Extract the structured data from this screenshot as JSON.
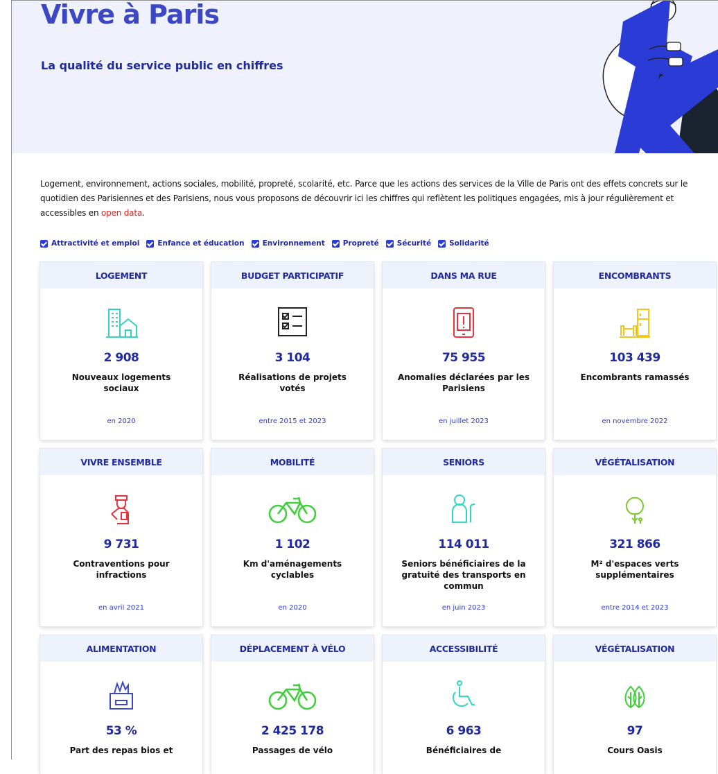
{
  "hero": {
    "title": "Vivre à Paris",
    "subtitle": "La qualité du service public en chiffres"
  },
  "intro": {
    "text": "Logement, environnement, actions sociales, mobilité, propreté, scolarité, etc. Parce que les actions des services de la Ville de Paris ont des effets concrets sur le quotidien des Parisiennes et des Parisiens, nous vous proposons de découvrir ici les chiffres qui reflètent les politiques engagées, mis à jour régulièrement et accessibles en ",
    "link_label": "open data",
    "suffix": "."
  },
  "filters": [
    {
      "label": "Attractivité et emploi",
      "checked": true
    },
    {
      "label": "Enfance et éducation",
      "checked": true
    },
    {
      "label": "Environnement",
      "checked": true
    },
    {
      "label": "Propreté",
      "checked": true
    },
    {
      "label": "Sécurité",
      "checked": true
    },
    {
      "label": "Solidarité",
      "checked": true
    }
  ],
  "cards": [
    {
      "title": "LOGEMENT",
      "icon": "building-house-icon",
      "color": "#2fd6c4",
      "value": "2 908",
      "label": "Nouveaux logements sociaux",
      "date": "en 2020"
    },
    {
      "title": "BUDGET PARTICIPATIF",
      "icon": "checklist-icon",
      "color": "#222222",
      "value": "3 104",
      "label": "Réalisations de projets votés",
      "date": "entre 2015 et 2023"
    },
    {
      "title": "DANS MA RUE",
      "icon": "phone-alert-icon",
      "color": "#e8333a",
      "value": "75 955",
      "label": "Anomalies déclarées par les Parisiens",
      "date": "en juillet 2023"
    },
    {
      "title": "ENCOMBRANTS",
      "icon": "furniture-icon",
      "color": "#f5c518",
      "value": "103 439",
      "label": "Encombrants ramassés",
      "date": "en novembre 2022"
    },
    {
      "title": "VIVRE ENSEMBLE",
      "icon": "police-officer-icon",
      "color": "#e8333a",
      "value": "9 731",
      "label": "Contraventions pour infractions",
      "date": "en avril 2021"
    },
    {
      "title": "MOBILITÉ",
      "icon": "bicycle-icon",
      "color": "#3fcf3a",
      "value": "1 102",
      "label": "Km d'aménagements cyclables",
      "date": "en 2020"
    },
    {
      "title": "SENIORS",
      "icon": "senior-icon",
      "color": "#2fd6c4",
      "value": "114 011",
      "label": "Seniors bénéficiaires de la gratuité des transports en commun",
      "date": "en juin 2023"
    },
    {
      "title": "VÉGÉTALISATION",
      "icon": "tree-icon",
      "color": "#7acb2a",
      "value": "321 866",
      "label": "M² d'espaces verts supplémentaires",
      "date": "entre 2014 et 2023"
    },
    {
      "title": "ALIMENTATION",
      "icon": "organic-basket-icon",
      "color": "#3b47c4",
      "value": "53 %",
      "label": "Part des repas bios et",
      "date": ""
    },
    {
      "title": "DÉPLACEMENT À VÉLO",
      "icon": "bicycle-icon",
      "color": "#3fcf3a",
      "value": "2 425 178",
      "label": "Passages de vélo",
      "date": ""
    },
    {
      "title": "ACCESSIBILITÉ",
      "icon": "wheelchair-icon",
      "color": "#2fd6c4",
      "value": "6 963",
      "label": "Bénéficiaires de",
      "date": ""
    },
    {
      "title": "VÉGÉTALISATION",
      "icon": "leaves-icon",
      "color": "#3fcf3a",
      "value": "97",
      "label": "Cours Oasis",
      "date": ""
    }
  ]
}
